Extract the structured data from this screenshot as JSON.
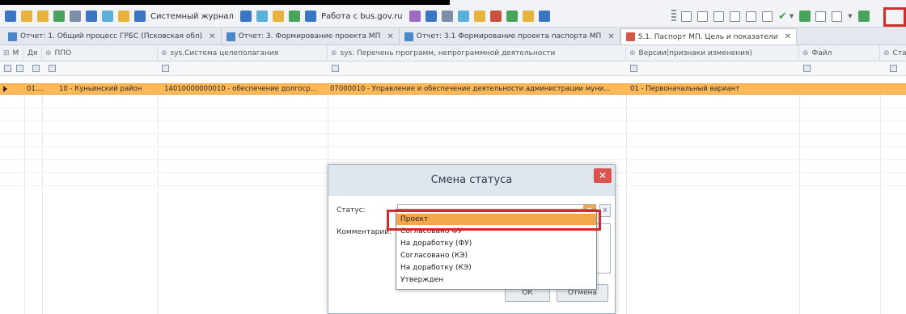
{
  "toolbar": {
    "journal_label": "Системный журнал",
    "bus_label": "Работа с bus.gov.ru"
  },
  "tabs": [
    {
      "label": "Отчет: 1. Общий процесс ГРБС (Псковская обл)",
      "close": "✕"
    },
    {
      "label": "Отчет: 3. Формирование проекта МП",
      "close": "✕"
    },
    {
      "label": "Отчет: 3.1 Формирование проекта паспорта МП",
      "close": "✕"
    },
    {
      "label": "5.1. Паспорт МП. Цель и показатели",
      "close": "✕"
    }
  ],
  "columns": [
    {
      "label": "М"
    },
    {
      "label": "Дя"
    },
    {
      "label": "ППО"
    },
    {
      "label": "sys.Система целеполагания"
    },
    {
      "label": "sys. Перечень программ, непрограммной деятельности"
    },
    {
      "label": "Версии(признаки изменения)"
    },
    {
      "label": "Файл"
    },
    {
      "label": "Ста"
    }
  ],
  "row": {
    "col1": "01....",
    "ppo": "10 - Куньинский район",
    "system": "14010000000010 - обеспечение долгоср...",
    "program": "07000010 - Управление и обеспечение деятельности администрации муни...",
    "version": "01 - Первоначальный вариант"
  },
  "dialog": {
    "title": "Смена статуса",
    "close_label": "✕",
    "status_label": "Статус:",
    "status_value": "",
    "clear_label": "x",
    "comment_label": "Комментарий:",
    "ok_label": "ОК",
    "cancel_label": "Отмена"
  },
  "dropdown": {
    "options": [
      "Проект",
      "Согласовано ФУ",
      "На доработку (ФУ)",
      "Согласовано (КЭ)",
      "На доработку (КЭ)",
      "Утвержден"
    ]
  },
  "colors": {
    "selection": "#fdb957",
    "highlight_red": "#d22b2b",
    "dropdown_selected": "#f4a64a",
    "close_red": "#d9534f"
  }
}
